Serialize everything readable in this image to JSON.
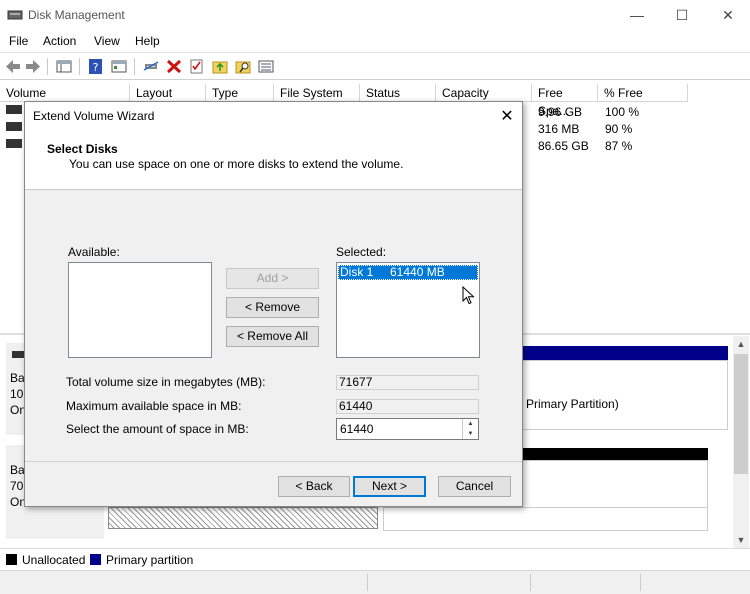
{
  "window": {
    "title": "Disk Management"
  },
  "menu": [
    "File",
    "Action",
    "View",
    "Help"
  ],
  "columns": [
    "Volume",
    "Layout",
    "Type",
    "File System",
    "Status",
    "Capacity",
    "Free Spa...",
    "% Free"
  ],
  "volumes": [
    {
      "free": "9.96 GB",
      "pct": "100 %"
    },
    {
      "free": "316 MB",
      "pct": "90 %"
    },
    {
      "free": "86.65 GB",
      "pct": "87 %"
    }
  ],
  "lower": {
    "primary_partition_text": "Primary Partition)",
    "disk0_frag": [
      "Ba",
      "10",
      "On"
    ],
    "disk1_frag": [
      "Ba",
      "70.",
      "On"
    ]
  },
  "legend": [
    {
      "label": "Unallocated",
      "color": "#000000"
    },
    {
      "label": "Primary partition",
      "color": "#00008b"
    }
  ],
  "dialog": {
    "title": "Extend Volume Wizard",
    "heading": "Select Disks",
    "subheading": "You can use space on one or more disks to extend the volume.",
    "available_label": "Available:",
    "selected_label": "Selected:",
    "selected_item": "Disk 1     61440 MB",
    "add_button": "Add >",
    "remove_button": "< Remove",
    "remove_all_button": "< Remove All",
    "total_label": "Total volume size in megabytes (MB):",
    "total_value": "71677",
    "max_label": "Maximum available space in MB:",
    "max_value": "61440",
    "select_label": "Select the amount of space in MB:",
    "select_value": "61440",
    "back_button": "< Back",
    "next_button": "Next >",
    "cancel_button": "Cancel"
  },
  "colors": {
    "selection": "#0078d7",
    "primary_partition": "#00008b"
  }
}
